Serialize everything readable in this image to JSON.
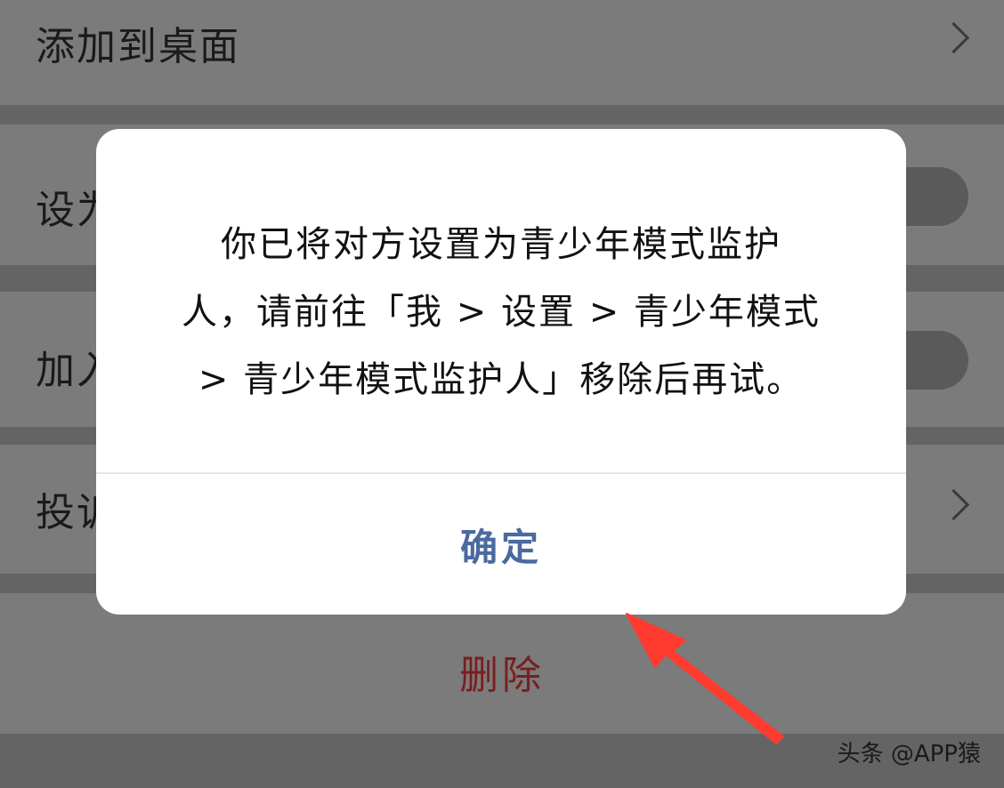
{
  "background_list": {
    "items": [
      {
        "label": "添加到桌面",
        "control": "chevron"
      },
      {
        "label": "设为",
        "control": "toggle"
      },
      {
        "label": "加入",
        "control": "toggle"
      },
      {
        "label": "投诉",
        "control": "chevron"
      }
    ],
    "delete_label": "删除"
  },
  "dialog": {
    "message": "你已将对方设置为青少年模式监护人，请前往「我 > 设置 > 青少年模式 > 青少年模式监护人」移除后再试。",
    "message_lines": [
      "你已将对方设置为青少年模式监护",
      "人，请前往「我 > 设置 > 青少年模式",
      "> 青少年模式监护人」移除后再试。"
    ],
    "confirm_label": "确定"
  },
  "annotation": {
    "arrow_color": "#ff3b30"
  },
  "watermark": {
    "text": "头条 @APP猿"
  },
  "colors": {
    "confirm": "#4a6aa0",
    "delete": "#7a1e1e",
    "overlay": "#6b6b6b"
  }
}
